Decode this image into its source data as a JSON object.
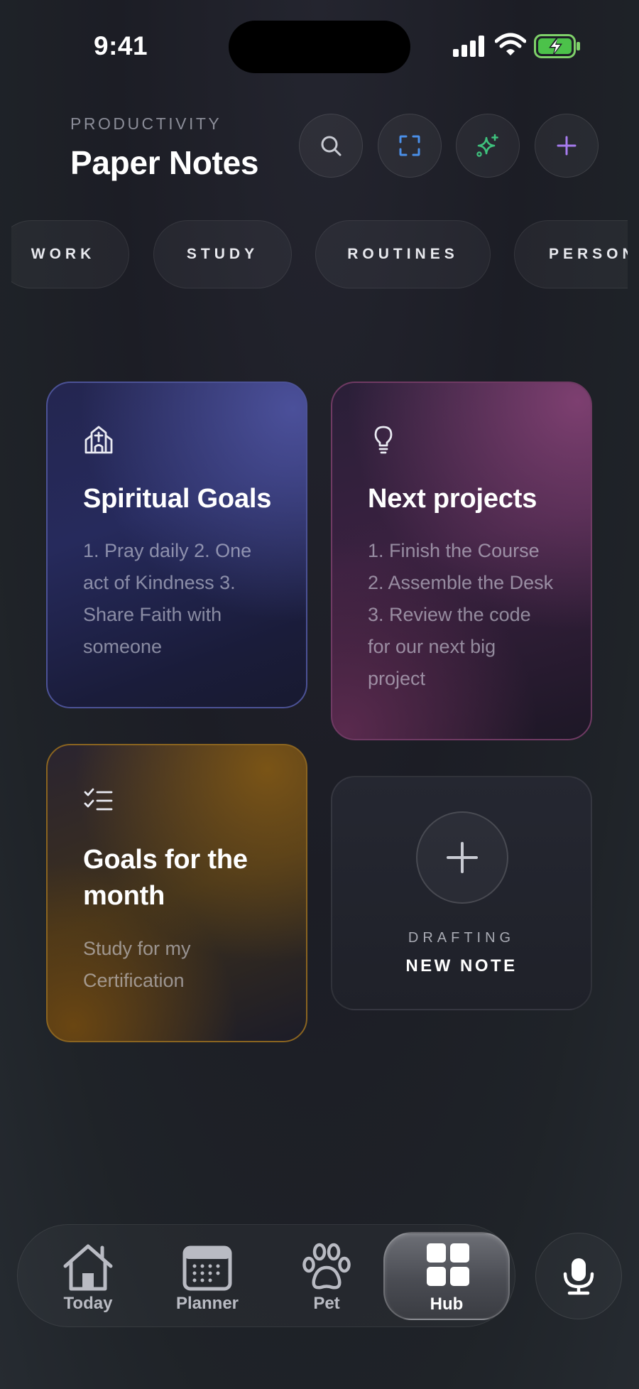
{
  "status_bar": {
    "time": "9:41"
  },
  "header": {
    "eyebrow": "PRODUCTIVITY",
    "title": "Paper Notes",
    "actions": [
      {
        "icon": "search-icon",
        "color": "#c9cbd3"
      },
      {
        "icon": "scan-icon",
        "color": "#4a8fe8"
      },
      {
        "icon": "sparkles-icon",
        "color": "#3fc27d"
      },
      {
        "icon": "plus-icon",
        "color": "#a77cf0"
      }
    ]
  },
  "categories": [
    "WORK",
    "STUDY",
    "ROUTINES",
    "PERSON"
  ],
  "notes": [
    {
      "icon": "church-icon",
      "title": "Spiritual Goals",
      "body": "1. Pray daily 2. One act of Kindness 3. Share Faith with someone",
      "accent": "#4c5296"
    },
    {
      "icon": "lightbulb-icon",
      "title": "Next projects",
      "body": "1. Finish the Course 2. Assemble the Desk 3. Review the code for our next big project",
      "accent": "#6f3a63"
    },
    {
      "icon": "checklist-icon",
      "title": "Goals for the month",
      "body": "Study for my Certification",
      "accent": "#8a6420"
    }
  ],
  "new_note": {
    "eyebrow": "DRAFTING",
    "label": "NEW NOTE"
  },
  "tabbar": {
    "tabs": [
      {
        "icon": "home-icon",
        "label": "Today"
      },
      {
        "icon": "calendar-icon",
        "label": "Planner"
      },
      {
        "icon": "paw-icon",
        "label": "Pet"
      },
      {
        "icon": "grid-icon",
        "label": "Hub",
        "active": true
      }
    ],
    "mic_icon": "microphone-icon"
  }
}
